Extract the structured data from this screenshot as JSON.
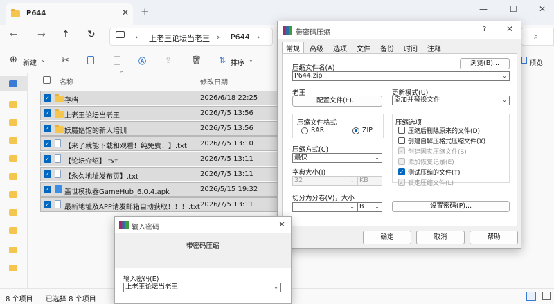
{
  "explorer": {
    "tab_title": "P644",
    "tab_close": "✕",
    "new_tab": "+",
    "window_controls": {
      "minimize": "—",
      "maximize": "☐",
      "close": "✕"
    },
    "breadcrumb": {
      "sep": "›",
      "items": [
        "上老王论坛当老王",
        "P644"
      ]
    },
    "toolbar": {
      "new_label": "新建",
      "sort_label": "排序",
      "preview_label": "预览"
    },
    "columns": {
      "name": "名称",
      "modified": "修改日期"
    },
    "files": [
      {
        "name": "存档",
        "date": "2026/6/18 22:25",
        "type": "folder"
      },
      {
        "name": "上老王论坛当老王",
        "date": "2026/7/5 13:56",
        "type": "folder"
      },
      {
        "name": "妖魔娼馆的新人培训",
        "date": "2026/7/5 13:56",
        "type": "folder"
      },
      {
        "name": "【来了就能下载和观看！纯免费！】.txt",
        "date": "2026/7/5 13:10",
        "type": "txt"
      },
      {
        "name": "【论坛介绍】.txt",
        "date": "2026/7/5 13:11",
        "type": "txt"
      },
      {
        "name": "【永久地址发布页】.txt",
        "date": "2026/7/5 13:11",
        "type": "txt"
      },
      {
        "name": "盖世模拟器GameHub_6.0.4.apk",
        "date": "2026/5/15 19:32",
        "type": "apk"
      },
      {
        "name": "最新地址及APP请发邮箱自动获取！！！.txt",
        "date": "2026/7/5 13:11",
        "type": "txt"
      }
    ],
    "status": {
      "count": "8 个项目",
      "selected": "已选择 8 个项目"
    }
  },
  "rar_dialog": {
    "title": "带密码压缩",
    "help_q": "?",
    "tabs": [
      "常规",
      "高级",
      "选项",
      "文件",
      "备份",
      "时间",
      "注释"
    ],
    "archive_name_label": "压缩文件名(A)",
    "browse_button": "浏览(B)...",
    "archive_name": "P644.zip",
    "profile_label": "老王",
    "profile_button": "配置文件(F)...",
    "update_mode_label": "更新模式(U)",
    "update_mode_value": "添加并替换文件",
    "format_label": "压缩文件格式",
    "format_options": [
      "RAR",
      "ZIP"
    ],
    "format_selected": "ZIP",
    "options_label": "压缩选项",
    "options": [
      {
        "label": "压缩后删除原来的文件(D)",
        "checked": false,
        "disabled": false
      },
      {
        "label": "创建自解压格式压缩文件(X)",
        "checked": false,
        "disabled": false
      },
      {
        "label": "创建固实压缩文件(S)",
        "checked": false,
        "disabled": true
      },
      {
        "label": "添加恢复记录(E)",
        "checked": false,
        "disabled": true
      },
      {
        "label": "测试压缩的文件(T)",
        "checked": true,
        "disabled": false
      },
      {
        "label": "锁定压缩文件(L)",
        "checked": false,
        "disabled": true
      }
    ],
    "method_label": "压缩方式(C)",
    "method_value": "最快",
    "dict_label": "字典大小(I)",
    "dict_value": "32",
    "dict_unit": "KB",
    "split_label": "切分为分卷(V)，大小",
    "split_unit": "B",
    "set_password_button": "设置密码(P)...",
    "ok_button": "确定",
    "cancel_button": "取消",
    "help_button": "帮助"
  },
  "password_dialog": {
    "title": "输入密码",
    "heading": "带密码压缩",
    "input_label": "输入密码(E)",
    "input_value": "上老王论坛当老王"
  }
}
